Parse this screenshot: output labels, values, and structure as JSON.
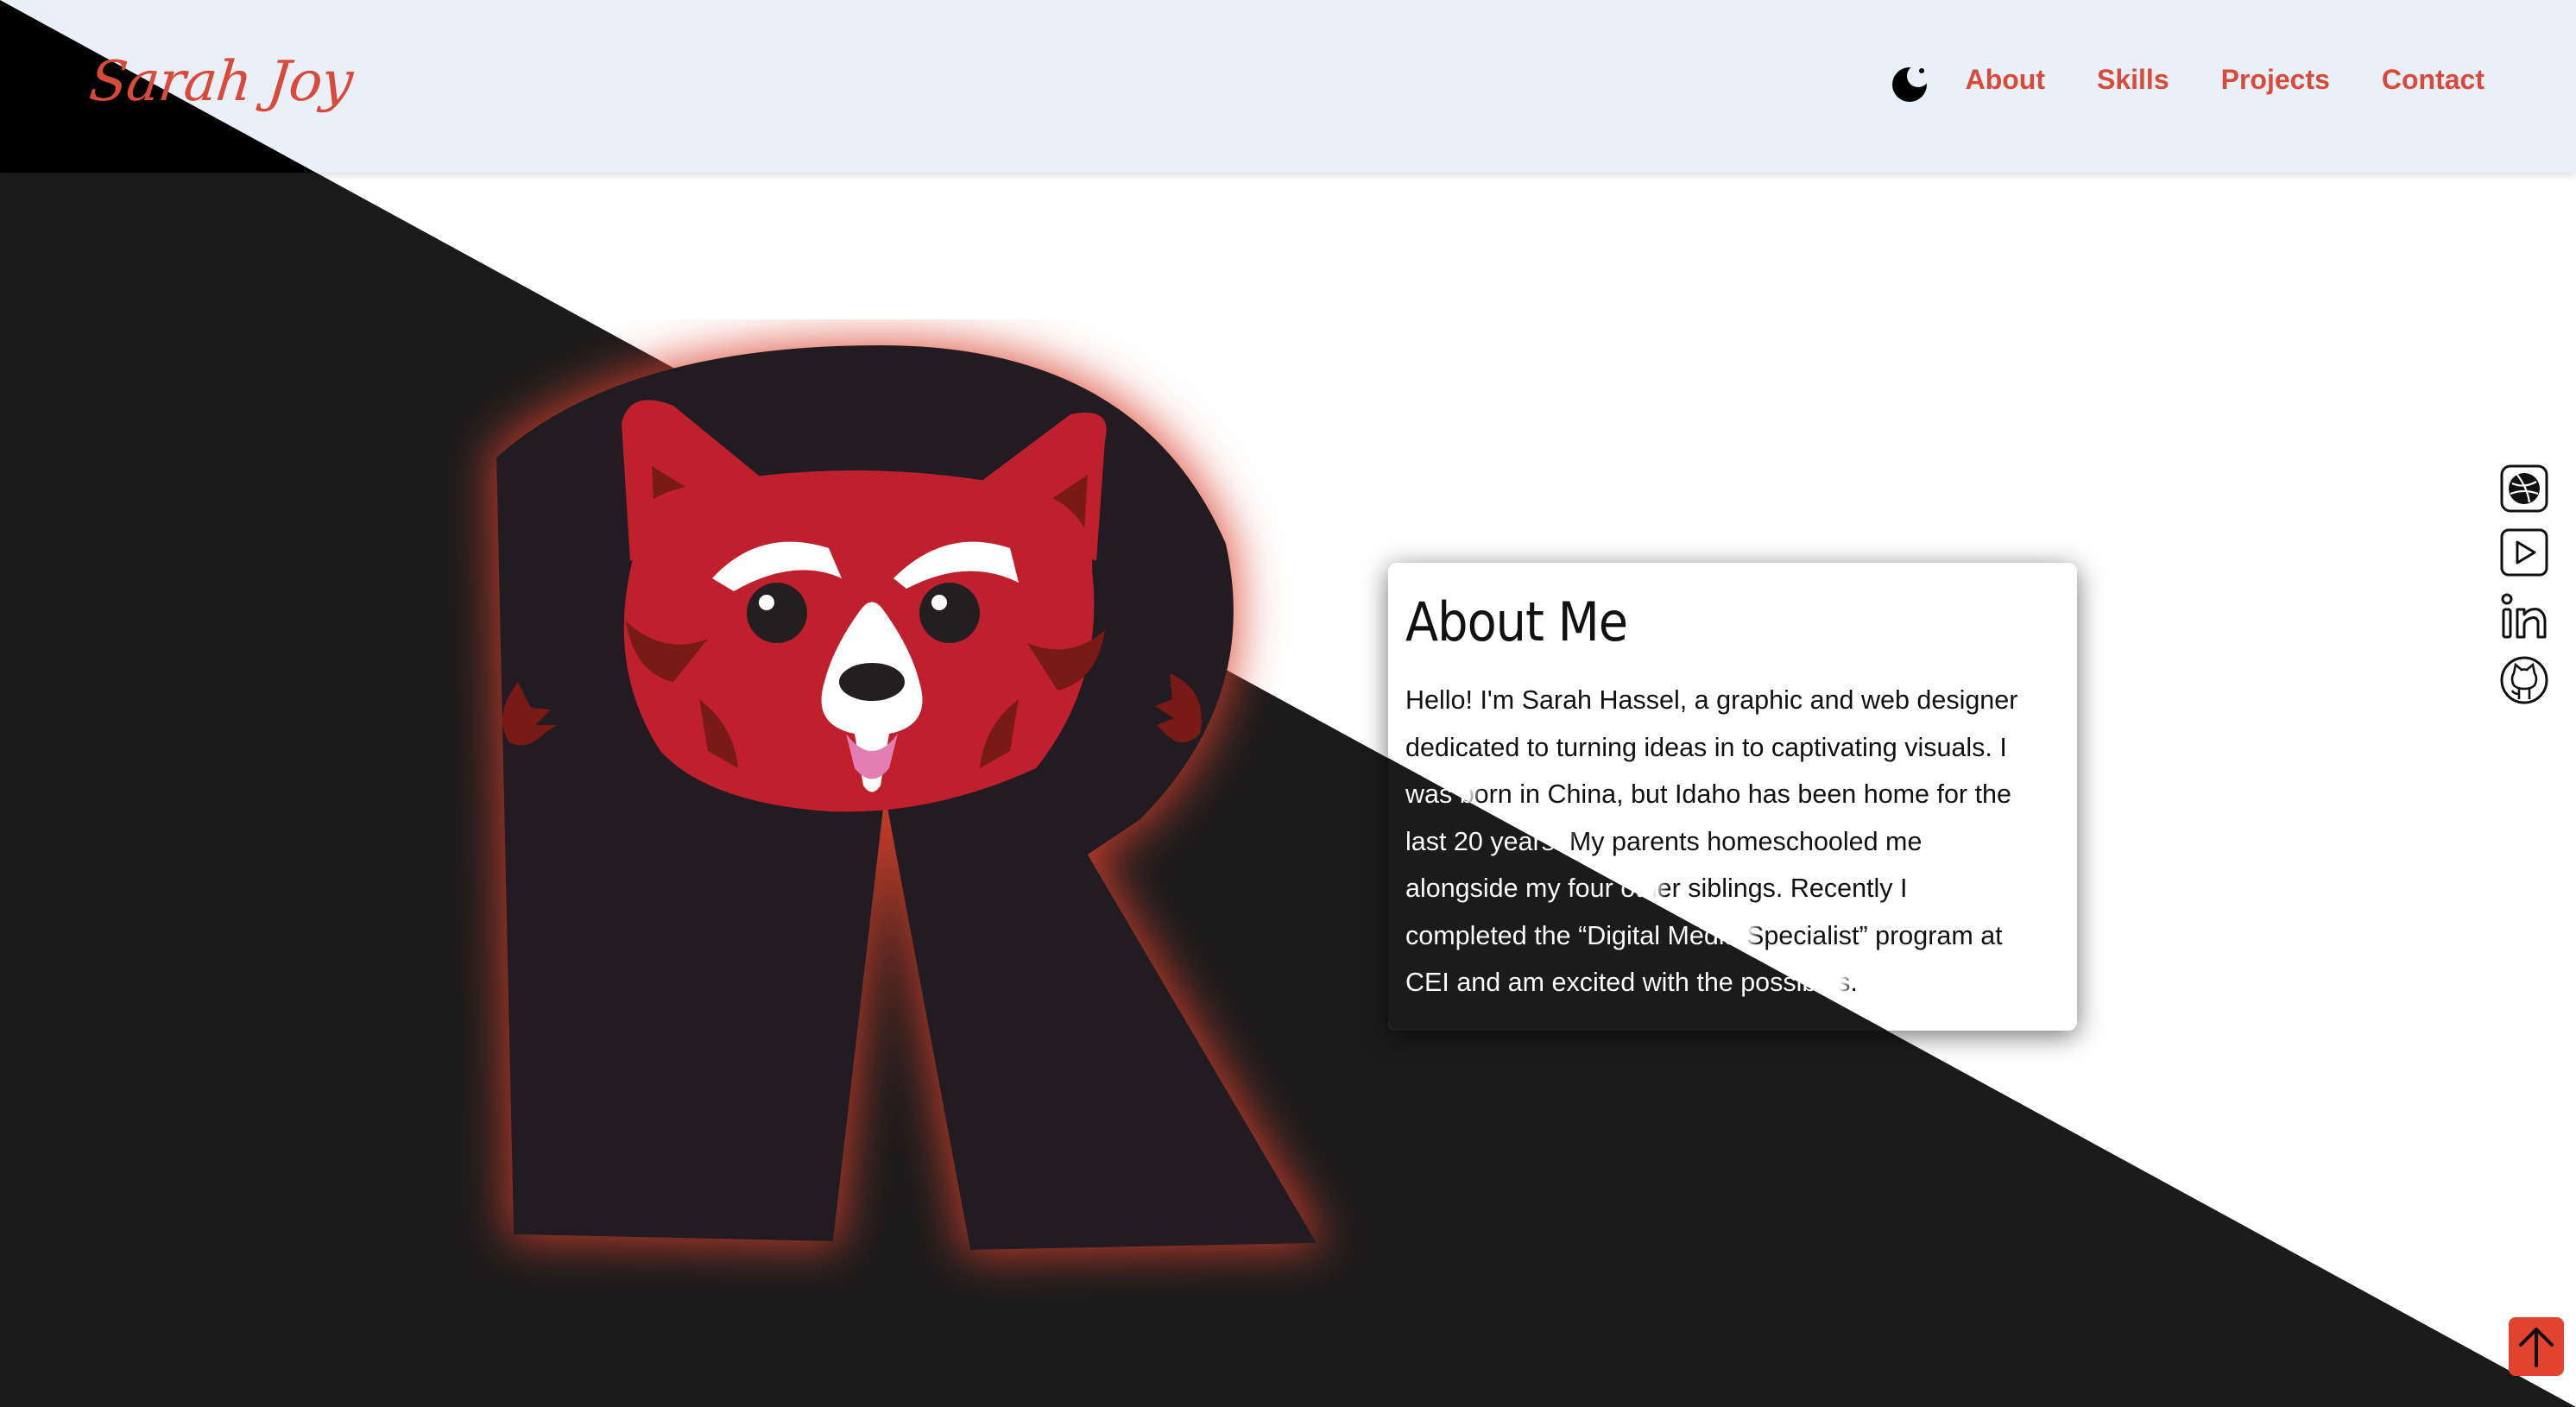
{
  "header": {
    "logo": "Sarah Joy",
    "nav": [
      {
        "label": "About"
      },
      {
        "label": "Skills"
      },
      {
        "label": "Projects"
      },
      {
        "label": "Contact"
      }
    ],
    "theme_icon": "moon-icon"
  },
  "about": {
    "title": "About Me",
    "lines": [
      "Hello! I'm Sarah Hassel, a graphic and web designer",
      "dedicated to turning ideas in to captivating visuals. I",
      "was born in China, but Idaho has been home for the",
      "last 20 years. My parents homeschooled me",
      "alongside my four other siblings. Recently I",
      "completed the “Digital Media Specialist” program at",
      "CEI and am excited with the possibles."
    ]
  },
  "social": [
    {
      "icon": "dribbble-icon"
    },
    {
      "icon": "youtube-play-icon"
    },
    {
      "icon": "linkedin-icon"
    },
    {
      "icon": "github-icon"
    }
  ],
  "scroll_top_icon": "arrow-up-icon",
  "colors": {
    "accent": "#d84a3a",
    "dark": "#1c1b1c",
    "header_bg": "#eaf0f9",
    "mascot_red": "#c0202e"
  }
}
